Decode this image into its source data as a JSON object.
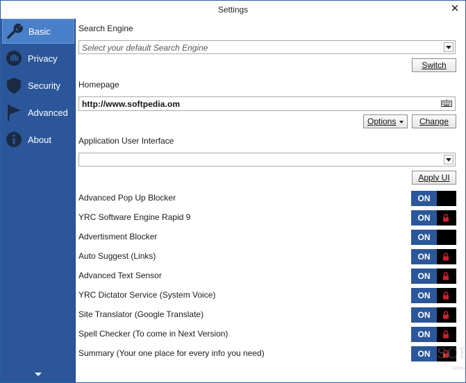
{
  "window": {
    "title": "Settings"
  },
  "sidebar": {
    "items": [
      {
        "label": "Basic",
        "icon": "wrench-icon",
        "active": true
      },
      {
        "label": "Privacy",
        "icon": "hand-stop-icon",
        "active": false
      },
      {
        "label": "Security",
        "icon": "shield-icon",
        "active": false
      },
      {
        "label": "Advanced",
        "icon": "flag-icon",
        "active": false
      },
      {
        "label": "About",
        "icon": "info-icon",
        "active": false
      }
    ]
  },
  "search_engine": {
    "label": "Search Engine",
    "placeholder": "Select your default Search Engine",
    "switch_button": "Switch"
  },
  "homepage": {
    "label": "Homepage",
    "value": "http://www.softpedia.om",
    "options_button": "Options",
    "change_button": "Change"
  },
  "app_ui": {
    "label": "Application User Interface",
    "selected": "",
    "apply_button": "Apply UI"
  },
  "toggles": [
    {
      "label": "Advanced Pop Up Blocker",
      "state": "ON",
      "locked": false
    },
    {
      "label": "YRC Software Engine Rapid 9",
      "state": "ON",
      "locked": true
    },
    {
      "label": "Advertisment Blocker",
      "state": "ON",
      "locked": false
    },
    {
      "label": "Auto Suggest (Links)",
      "state": "ON",
      "locked": true
    },
    {
      "label": "Advanced Text Sensor",
      "state": "ON",
      "locked": true
    },
    {
      "label": "YRC Dictator Service (System Voice)",
      "state": "ON",
      "locked": true
    },
    {
      "label": "Site Translator (Google Translate)",
      "state": "ON",
      "locked": true
    },
    {
      "label": "Spell Checker (To come in Next Version)",
      "state": "ON",
      "locked": true
    },
    {
      "label": "Summary (Your one place for every info you need)",
      "state": "ON",
      "locked": true
    }
  ],
  "watermark": {
    "text": "SOFTPEDIA",
    "sub": "www.softpedia.com"
  },
  "colors": {
    "sidebar": "#2b579a",
    "active_item": "#4a7fc9",
    "toggle_on": "#2b579a",
    "lock": "#d21f2f"
  }
}
